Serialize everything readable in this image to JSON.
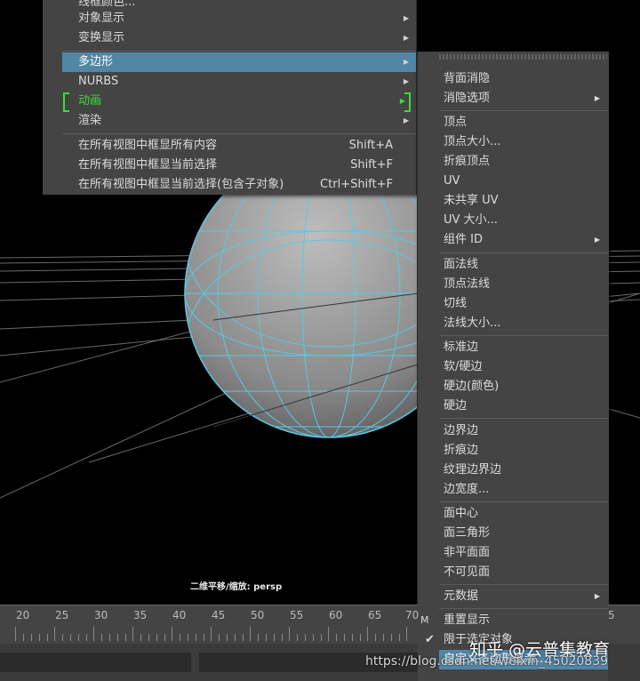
{
  "viewport": {
    "camera_label": "二维平移/缩放: persp"
  },
  "main_menu": {
    "items": [
      {
        "label": "线框颜色...",
        "arrow": ""
      },
      {
        "label": "对象显示",
        "arrow": "▶"
      },
      {
        "label": "变换显示",
        "arrow": "▶"
      },
      {
        "label": "多边形",
        "arrow": "▶"
      },
      {
        "label": "NURBS",
        "arrow": "▶"
      },
      {
        "label": "动画",
        "arrow": "▶"
      },
      {
        "label": "渲染",
        "arrow": "▶"
      },
      {
        "label": "在所有视图中框显所有内容",
        "shortcut": "Shift+A"
      },
      {
        "label": "在所有视图中框显当前选择",
        "shortcut": "Shift+F"
      },
      {
        "label": "在所有视图中框显当前选择(包含子对象)",
        "shortcut": "Ctrl+Shift+F"
      }
    ]
  },
  "sub_menu": {
    "items": [
      {
        "label": "背面消隐",
        "arrow": ""
      },
      {
        "label": "消隐选项",
        "arrow": "▶"
      },
      {
        "label": "顶点",
        "arrow": ""
      },
      {
        "label": "顶点大小...",
        "arrow": ""
      },
      {
        "label": "折痕顶点",
        "arrow": ""
      },
      {
        "label": "UV",
        "arrow": ""
      },
      {
        "label": "未共享 UV",
        "arrow": ""
      },
      {
        "label": "UV 大小...",
        "arrow": ""
      },
      {
        "label": "组件 ID",
        "arrow": "▶"
      },
      {
        "label": "面法线",
        "arrow": ""
      },
      {
        "label": "顶点法线",
        "arrow": ""
      },
      {
        "label": "切线",
        "arrow": ""
      },
      {
        "label": "法线大小...",
        "arrow": ""
      },
      {
        "label": "标准边",
        "arrow": ""
      },
      {
        "label": "软/硬边",
        "arrow": ""
      },
      {
        "label": "硬边(颜色)",
        "arrow": ""
      },
      {
        "label": "硬边",
        "arrow": ""
      },
      {
        "label": "边界边",
        "arrow": ""
      },
      {
        "label": "折痕边",
        "arrow": ""
      },
      {
        "label": "纹理边界边",
        "arrow": ""
      },
      {
        "label": "边宽度...",
        "arrow": ""
      },
      {
        "label": "面中心",
        "arrow": ""
      },
      {
        "label": "面三角形",
        "arrow": ""
      },
      {
        "label": "非平面面",
        "arrow": ""
      },
      {
        "label": "不可见面",
        "arrow": ""
      },
      {
        "label": "元数据",
        "arrow": "▶"
      },
      {
        "label": "重置显示",
        "arrow": ""
      },
      {
        "label": "限于选定对象",
        "check": "✔"
      },
      {
        "label": "自定义多边形显示...",
        "arrow": ""
      }
    ]
  },
  "timeline": {
    "ticks": [
      "20",
      "25",
      "30",
      "35",
      "40",
      "45",
      "50",
      "55",
      "60",
      "65",
      "70"
    ],
    "right_tick": "5",
    "marker": "M"
  },
  "watermark": {
    "title": "知乎 @云普集教育",
    "url": "https://blog.csdn.net/weixin_45020839"
  },
  "colors": {
    "highlight": "#5285a6",
    "wire": "#5ac8e6",
    "green": "#3cdc3c",
    "menu_bg": "#444444"
  }
}
